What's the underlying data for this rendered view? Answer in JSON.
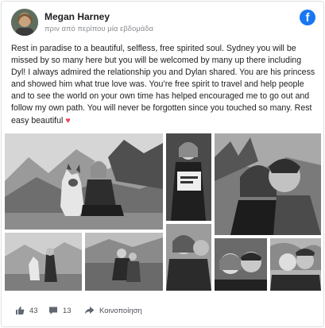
{
  "post": {
    "author": "Megan Harney",
    "timestamp": "πριν από περίπου μία εβδομάδα",
    "platform_icon": "facebook-icon",
    "text": "Rest in paradise to a beautiful, selfless, free spirited soul. Sydney you will be missed by so many here but you will be welcomed by many up there including Dyl! I always admired the relationship you and Dylan shared. You are his princess and showed him what true love was. You’re free spirit to travel and help people and to see the world on your own time has helped encouraged me to go out and follow my own path. You will never be forgotten since you touched so many. Rest easy beautiful",
    "text_emoji": "♥"
  },
  "actions": {
    "likes_count": "43",
    "comments_count": "13",
    "share_label": "Κοινοποίηση",
    "like_icon": "thumbs-up-icon",
    "comment_icon": "comment-icon",
    "share_icon": "share-arrow-icon"
  },
  "colors": {
    "facebook_blue": "#1877f2",
    "text": "#1c1e21",
    "muted": "#8a8d91",
    "action_gray": "#4b4f56",
    "heart": "#e8445a"
  }
}
